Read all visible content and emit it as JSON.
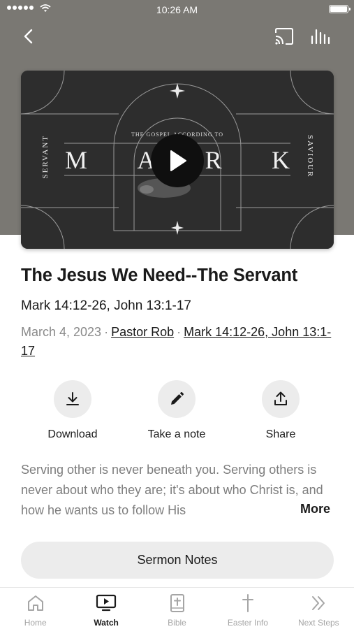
{
  "status_bar": {
    "time": "10:26 AM"
  },
  "video": {
    "artwork": {
      "subtitle": "THE GOSPEL ACCORDING TO",
      "title_letters": [
        "M",
        "A",
        "R",
        "K"
      ],
      "left_side": "SERVANT",
      "right_side": "SAVIOUR"
    }
  },
  "sermon": {
    "title": "The Jesus We Need--The Servant",
    "scripture": "Mark 14:12-26, John 13:1-17",
    "date": "March 4, 2023",
    "speaker": "Pastor Rob",
    "scripture_link": "Mark 14:12-26, John 13:1-17",
    "description": "Serving other is never beneath you. Serving others is never about who they are; it's about who Christ is, and how he wants us to follow His",
    "more_label": "More"
  },
  "actions": [
    {
      "label": "Download",
      "icon": "download-icon"
    },
    {
      "label": "Take a note",
      "icon": "pencil-icon"
    },
    {
      "label": "Share",
      "icon": "share-icon"
    }
  ],
  "notes_button": "Sermon Notes",
  "tabs": [
    {
      "label": "Home",
      "icon": "home-icon",
      "active": false
    },
    {
      "label": "Watch",
      "icon": "tv-play-icon",
      "active": true
    },
    {
      "label": "Bible",
      "icon": "bible-icon",
      "active": false
    },
    {
      "label": "Easter Info",
      "icon": "cross-icon",
      "active": false
    },
    {
      "label": "Next Steps",
      "icon": "double-chevron-icon",
      "active": false
    }
  ],
  "colors": {
    "hero_bg": "#7a7873",
    "button_bg": "#ececec",
    "text": "#1a1a1a",
    "muted": "#8a8a8a"
  }
}
